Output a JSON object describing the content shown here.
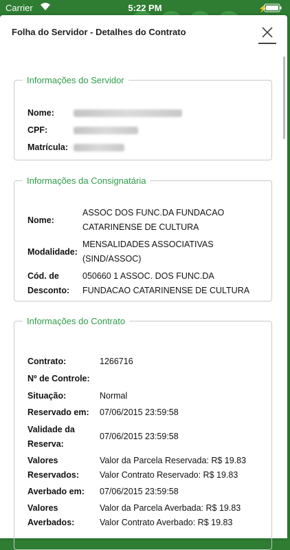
{
  "status_bar": {
    "carrier": "Carrier",
    "time": "5:22 PM"
  },
  "modal": {
    "title": "Folha do Servidor - Detalhes do Contrato",
    "close_icon": "close-icon"
  },
  "servidor": {
    "legend": "Informações do Servidor",
    "nome_label": "Nome:",
    "cpf_label": "CPF:",
    "matricula_label": "Matrícula:"
  },
  "consignataria": {
    "legend": "Informações da Consignatária",
    "nome_label": "Nome:",
    "nome_line1": "ASSOC DOS FUNC.DA FUNDACAO",
    "nome_line2": "CATARINENSE DE CULTURA",
    "modalidade_label": "Modalidade:",
    "modalidade_line1": "MENSALIDADES ASSOCIATIVAS",
    "modalidade_line2": "(SIND/ASSOC)",
    "cod_label_line1": "Cód. de",
    "cod_label_line2": "Desconto:",
    "cod_line1": "050660 1 ASSOC. DOS FUNC.DA",
    "cod_line2": "FUNDACAO CATARINENSE DE CULTURA"
  },
  "contrato": {
    "legend": "Informações do Contrato",
    "contrato_label": "Contrato:",
    "contrato_value": "1266716",
    "controle_label": "Nº de Controle:",
    "situacao_label": "Situação:",
    "situacao_value": "Normal",
    "reservado_label": "Reservado em:",
    "reservado_value": "07/06/2015 23:59:58",
    "validade_label_line1": "Validade da",
    "validade_label_line2": "Reserva:",
    "validade_value": "07/06/2015 23:59:58",
    "valores_res_label_line1": "Valores",
    "valores_res_label_line2": "Reservados:",
    "valores_res_line1": "Valor da Parcela Reservada: R$ 19.83",
    "valores_res_line2": "Valor Contrato Reservado: R$ 19.83",
    "averbado_label": "Averbado em:",
    "averbado_value": "07/06/2015 23:59:58",
    "valores_av_label_line1": "Valores",
    "valores_av_label_line2": "Averbados:",
    "valores_av_line1": "Valor da Parcela Averbada: R$ 19.83",
    "valores_av_line2": "Valor Contrato Averbado: R$ 19.83"
  }
}
